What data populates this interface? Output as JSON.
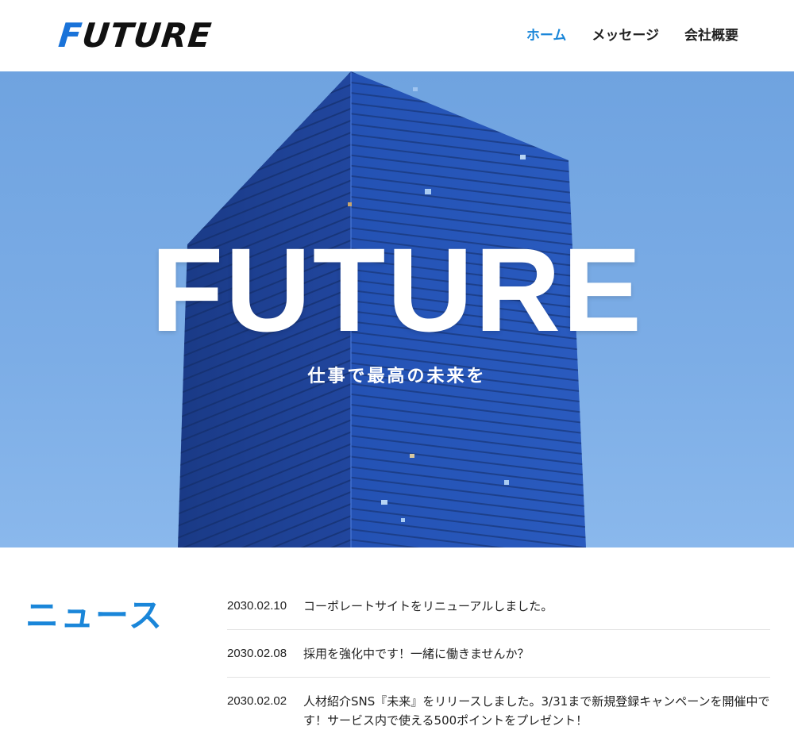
{
  "header": {
    "logo_letter_f": "F",
    "logo_rest": "UTURE",
    "nav": [
      {
        "label": "ホーム",
        "active": true
      },
      {
        "label": "メッセージ",
        "active": false
      },
      {
        "label": "会社概要",
        "active": false
      }
    ]
  },
  "hero": {
    "title": "FUTURE",
    "subtitle": "仕事で最高の未来を"
  },
  "news": {
    "heading": "ニュース",
    "items": [
      {
        "date": "2030.02.10",
        "text": "コーポレートサイトをリニューアルしました。"
      },
      {
        "date": "2030.02.08",
        "text": "採用を強化中です！一緒に働きませんか？"
      },
      {
        "date": "2030.02.02",
        "text": "人材紹介SNS『未来』をリリースしました。3/31まで新規登録キャンペーンを開催中です！サービス内で使える500ポイントをプレゼント！"
      }
    ]
  },
  "colors": {
    "accent": "#1a86d9",
    "logo_f": "#1a73d9",
    "sky": "#7cade6",
    "building_dark": "#1e3f8f",
    "building_face": "#2350b0"
  }
}
